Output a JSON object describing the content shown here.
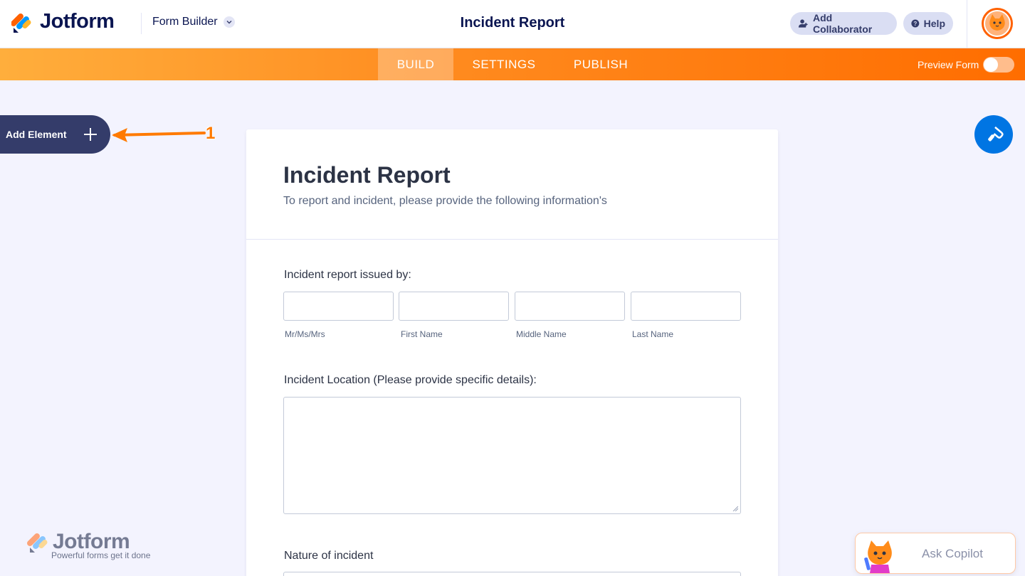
{
  "header": {
    "logo_text": "Jotform",
    "builder_label": "Form Builder",
    "form_title": "Incident Report",
    "add_collaborator_label": "Add Collaborator",
    "help_label": "Help"
  },
  "nav": {
    "tabs": [
      {
        "label": "BUILD",
        "active": true
      },
      {
        "label": "SETTINGS",
        "active": false
      },
      {
        "label": "PUBLISH",
        "active": false
      }
    ],
    "preview_label": "Preview Form",
    "preview_on": false
  },
  "sidebar": {
    "add_element_label": "Add Element",
    "annotation_number": "1"
  },
  "form": {
    "title": "Incident Report",
    "subtitle": "To report and incident, please provide the following information's",
    "q1": {
      "label": "Incident report issued by:",
      "fields": [
        {
          "sublabel": "Mr/Ms/Mrs",
          "value": ""
        },
        {
          "sublabel": "First Name",
          "value": ""
        },
        {
          "sublabel": "Middle Name",
          "value": ""
        },
        {
          "sublabel": "Last Name",
          "value": ""
        }
      ]
    },
    "q2": {
      "label": "Incident Location (Please provide specific details):",
      "value": ""
    },
    "q3": {
      "label": "Nature of incident"
    }
  },
  "watermark": {
    "brand": "Jotform",
    "tagline": "Powerful forms get it done"
  },
  "copilot": {
    "label": "Ask Copilot"
  },
  "colors": {
    "brand_navy": "#0A1551",
    "nav_orange": "#FF6D00",
    "nav_orange_light": "#FFAE3C",
    "designer_blue": "#0075E3",
    "sidebar_dark": "#343C6A",
    "canvas_bg": "#F3F3FE"
  },
  "icons": {
    "logo": "jotform-logo-icon",
    "chevron": "chevron-down-icon",
    "collaborator": "add-user-icon",
    "help": "question-circle-icon",
    "add": "plus-icon",
    "designer": "paint-roller-icon"
  }
}
